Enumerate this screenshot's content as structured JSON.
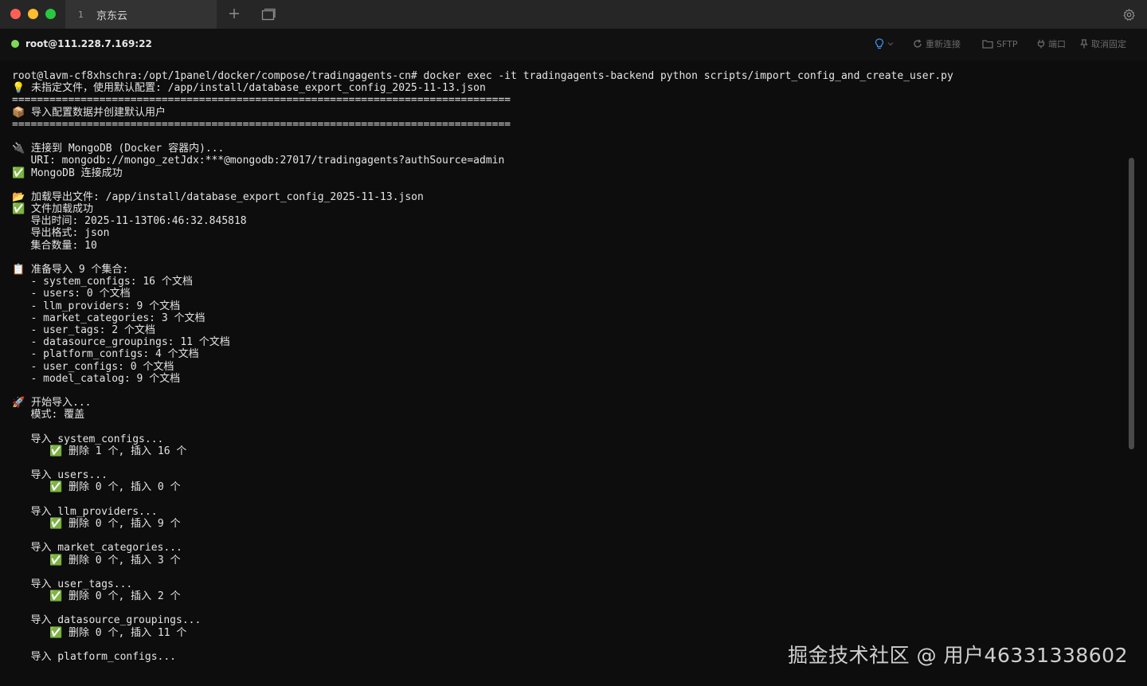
{
  "window": {
    "tab_index": "1",
    "tab_title": "京东云"
  },
  "session": {
    "host": "root@111.228.7.169:22",
    "status_color": "#7ed957",
    "toolbar": {
      "reconnect": "重新连接",
      "sftp": "SFTP",
      "port": "端口",
      "unpin": "取消固定"
    }
  },
  "terminal": {
    "lines": [
      "root@lavm-cf8xhschra:/opt/1panel/docker/compose/tradingagents-cn# docker exec -it tradingagents-backend python scripts/import_config_and_create_user.py",
      "💡 未指定文件，使用默认配置: /app/install/database_export_config_2025-11-13.json",
      "================================================================================",
      "📦 导入配置数据并创建默认用户",
      "================================================================================",
      "",
      "🔌 连接到 MongoDB (Docker 容器内)...",
      "   URI: mongodb://mongo_zetJdx:***@mongodb:27017/tradingagents?authSource=admin",
      "✅ MongoDB 连接成功",
      "",
      "📂 加载导出文件: /app/install/database_export_config_2025-11-13.json",
      "✅ 文件加载成功",
      "   导出时间: 2025-11-13T06:46:32.845818",
      "   导出格式: json",
      "   集合数量: 10",
      "",
      "📋 准备导入 9 个集合:",
      "   - system_configs: 16 个文档",
      "   - users: 0 个文档",
      "   - llm_providers: 9 个文档",
      "   - market_categories: 3 个文档",
      "   - user_tags: 2 个文档",
      "   - datasource_groupings: 11 个文档",
      "   - platform_configs: 4 个文档",
      "   - user_configs: 0 个文档",
      "   - model_catalog: 9 个文档",
      "",
      "🚀 开始导入...",
      "   模式: 覆盖",
      "",
      "   导入 system_configs...",
      "      ✅ 删除 1 个, 插入 16 个",
      "",
      "   导入 users...",
      "      ✅ 删除 0 个, 插入 0 个",
      "",
      "   导入 llm_providers...",
      "      ✅ 删除 0 个, 插入 9 个",
      "",
      "   导入 market_categories...",
      "      ✅ 删除 0 个, 插入 3 个",
      "",
      "   导入 user_tags...",
      "      ✅ 删除 0 个, 插入 2 个",
      "",
      "   导入 datasource_groupings...",
      "      ✅ 删除 0 个, 插入 11 个",
      "",
      "   导入 platform_configs..."
    ]
  },
  "watermark": "掘金技术社区 @ 用户46331338602"
}
